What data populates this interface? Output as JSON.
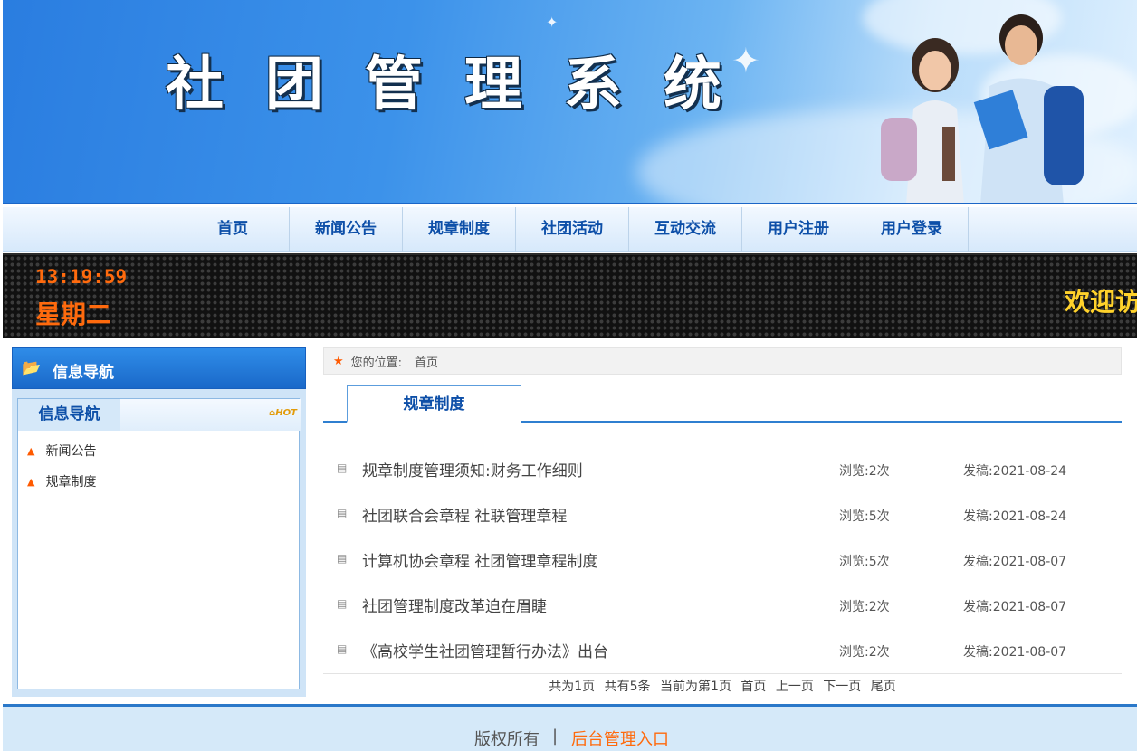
{
  "banner": {
    "title": "社团管理系统"
  },
  "nav": {
    "items": [
      {
        "label": "首页"
      },
      {
        "label": "新闻公告"
      },
      {
        "label": "规章制度"
      },
      {
        "label": "社团活动"
      },
      {
        "label": "互动交流"
      },
      {
        "label": "用户注册"
      },
      {
        "label": "用户登录"
      }
    ]
  },
  "ticker": {
    "time": "13:19:59",
    "weekday": "星期二",
    "marquee": "欢迎访问"
  },
  "sidebar": {
    "header_title": "信息导航",
    "tab_label": "信息导航",
    "hot_badge": "HOT",
    "links": [
      {
        "label": "新闻公告"
      },
      {
        "label": "规章制度"
      }
    ]
  },
  "breadcrumb": {
    "prefix": "您的位置:",
    "current": "首页"
  },
  "content": {
    "tab_label": "规章制度",
    "rows": [
      {
        "title": "规章制度管理须知:财务工作细则",
        "views": "浏览:2次",
        "date": "发稿:2021-08-24"
      },
      {
        "title": "社团联合会章程 社联管理章程",
        "views": "浏览:5次",
        "date": "发稿:2021-08-24"
      },
      {
        "title": "计算机协会章程 社团管理章程制度",
        "views": "浏览:5次",
        "date": "发稿:2021-08-07"
      },
      {
        "title": "社团管理制度改革迫在眉睫",
        "views": "浏览:2次",
        "date": "发稿:2021-08-07"
      },
      {
        "title": "《高校学生社团管理暂行办法》出台",
        "views": "浏览:2次",
        "date": "发稿:2021-08-07"
      }
    ]
  },
  "pager": {
    "total_pages": "共为1页",
    "total_items": "共有5条",
    "current": "当前为第1页",
    "first": "首页",
    "prev": "上一页",
    "next": "下一页",
    "last": "尾页"
  },
  "footer": {
    "copyright": "版权所有",
    "separator": "|",
    "admin_link": "后台管理入口"
  },
  "colors": {
    "brand_blue": "#0d4fa8",
    "accent_orange": "#ff6a0d",
    "ticker_yellow": "#ffd22b"
  },
  "icons": {
    "breadcrumb": "star-icon",
    "sidebar_header": "folder-icon",
    "list_item": "document-icon",
    "sidebar_link": "arrow-up-icon"
  }
}
